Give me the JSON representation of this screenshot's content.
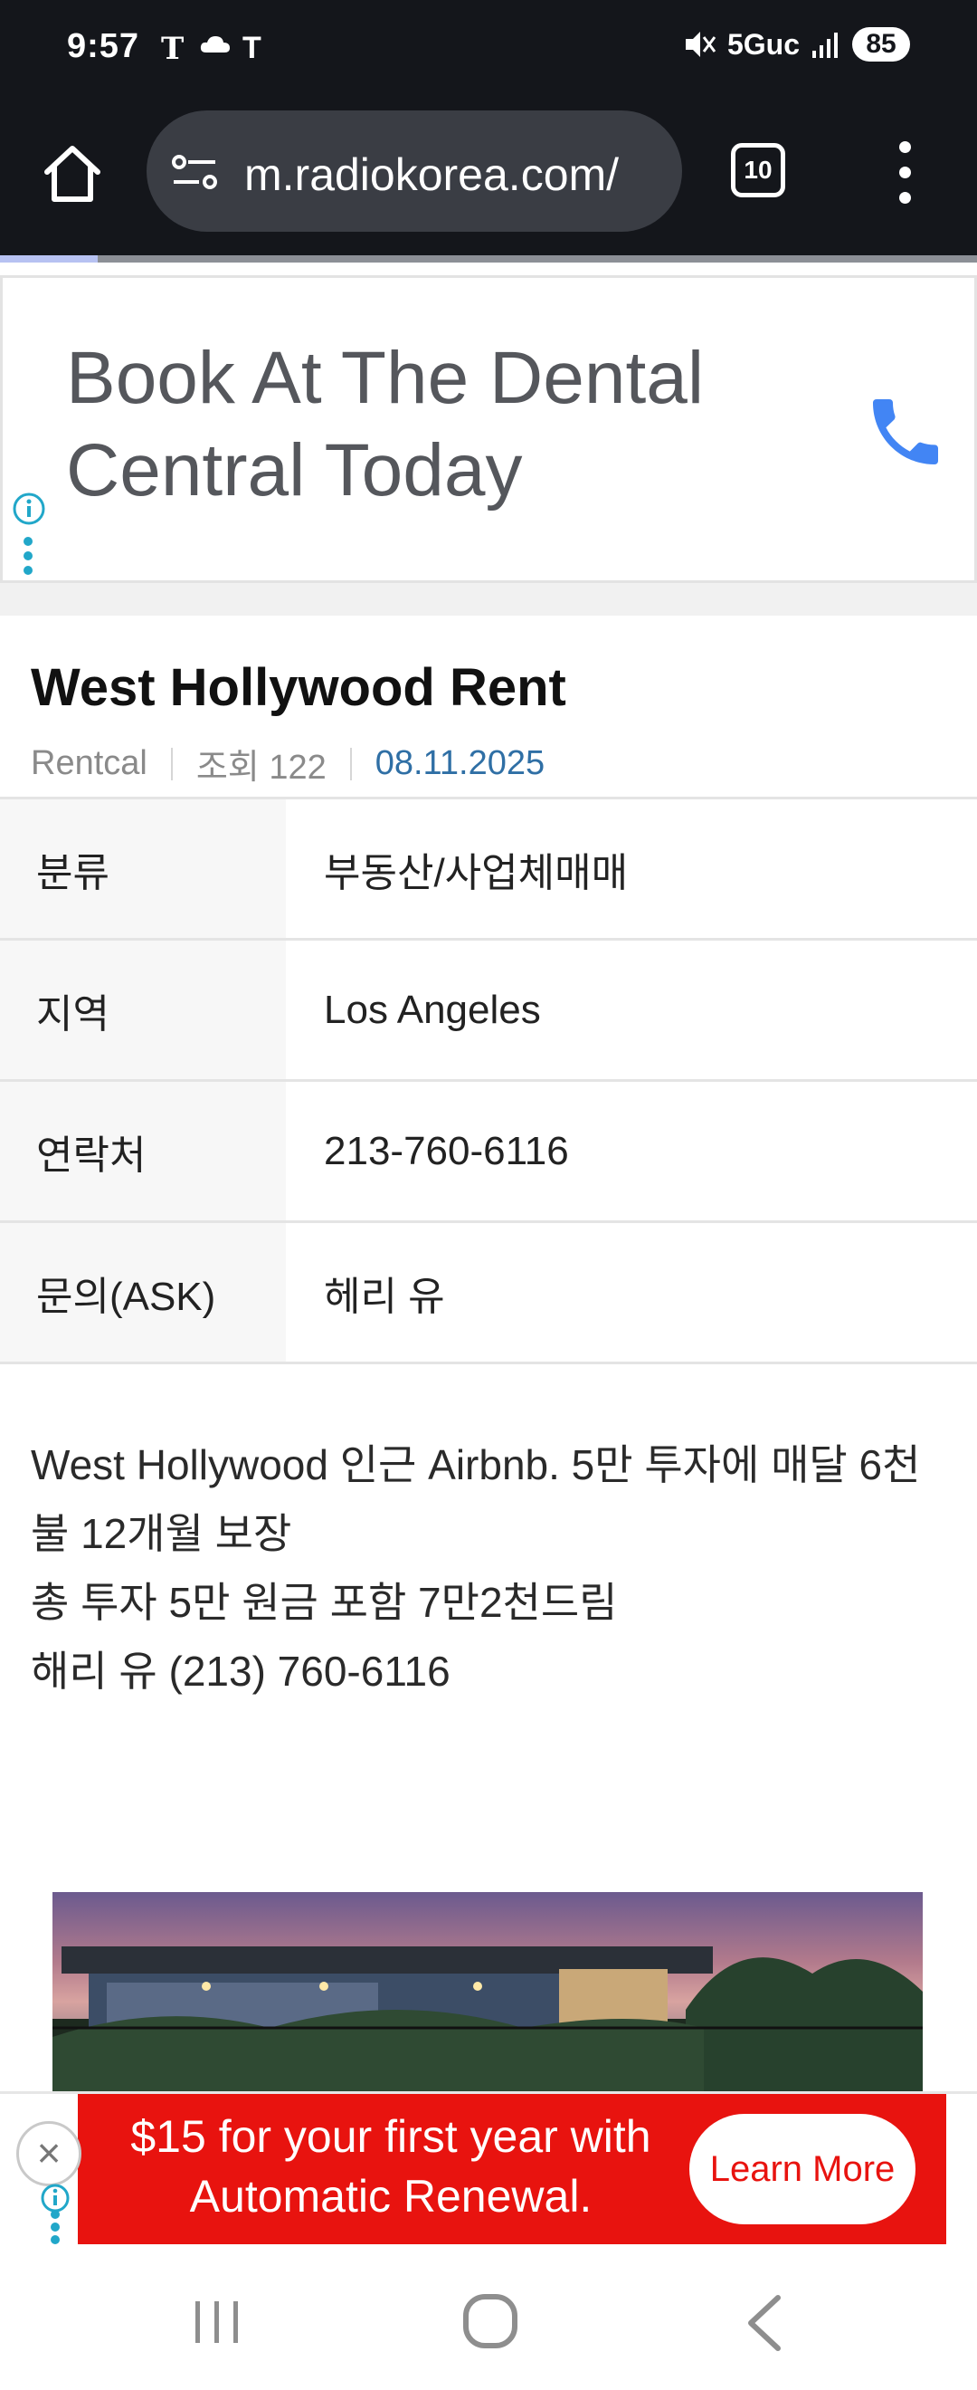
{
  "status_bar": {
    "time": "9:57",
    "carrier_1": "T",
    "carrier_2": "T",
    "network": "5Guc",
    "battery": "85"
  },
  "browser": {
    "url": "m.radiokorea.com/",
    "tab_count": "10",
    "load_progress": 0.1
  },
  "ad_top": {
    "headline": "Book At The Dental Central Today",
    "icon": "phone-icon"
  },
  "post": {
    "title": "West Hollywood Rent",
    "author": "Rentcal",
    "views": "조회 122",
    "date": "08.11.2025"
  },
  "info_table": [
    {
      "label": "분류",
      "value": "부동산/사업체매매"
    },
    {
      "label": "지역",
      "value": "Los Angeles"
    },
    {
      "label": "연락처",
      "value": "213-760-6116"
    },
    {
      "label": "문의(ASK)",
      "value": "헤리 유"
    }
  ],
  "body": {
    "line1": "West Hollywood 인근 Airbnb. 5만 투자에 매달 6천불 12개월 보장",
    "line2": "총 투자 5만 원금 포함 7만2천드림",
    "line3": "해리 유 (213) 760-6116"
  },
  "ad_bottom": {
    "text": "$15 for your first year with Automatic Renewal.",
    "button": "Learn More"
  },
  "colors": {
    "dark_bar": "#14161b",
    "link_blue": "#2f6fa5",
    "ad_red": "#e8130f",
    "ad_info": "#21a7c9"
  }
}
